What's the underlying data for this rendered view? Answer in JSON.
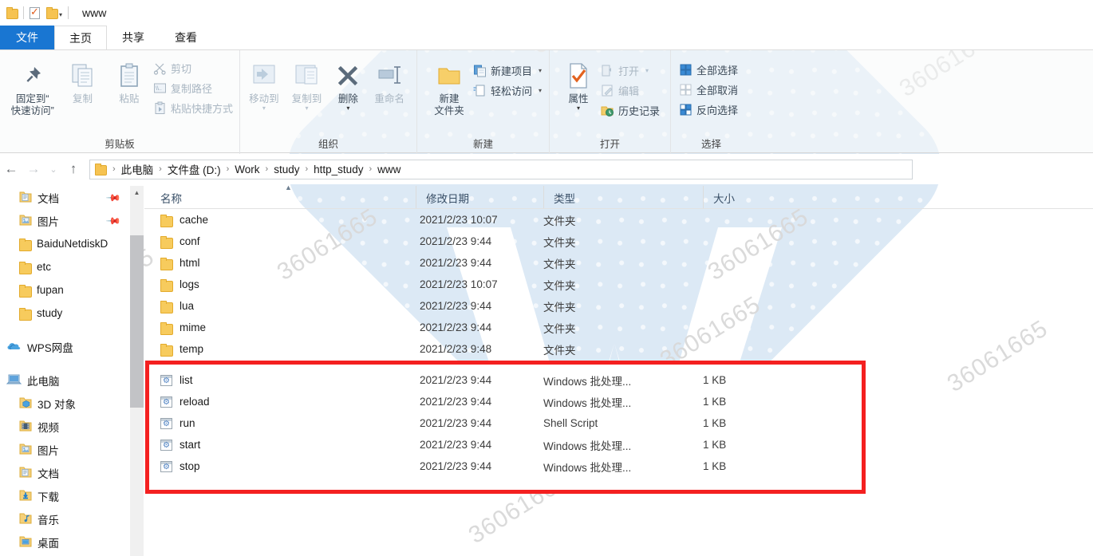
{
  "window": {
    "title": "www",
    "quick_access": {
      "folder_icon": "folder-icon",
      "properties_icon": "properties-check-icon",
      "new_folder_icon": "folder-icon",
      "customize_caret": "chevron-down-icon"
    }
  },
  "tabs": [
    {
      "label": "文件",
      "type": "file",
      "active": false
    },
    {
      "label": "主页",
      "type": "normal",
      "active": true
    },
    {
      "label": "共享",
      "type": "normal",
      "active": false
    },
    {
      "label": "查看",
      "type": "normal",
      "active": false
    }
  ],
  "ribbon": {
    "groups": [
      {
        "title": "剪贴板",
        "big_buttons": [
          {
            "label": "固定到“\n快速访问”",
            "line1": "固定到“",
            "line2": "快速访问”",
            "icon": "pin-icon",
            "dim": false
          },
          {
            "label": "复制",
            "line1": "复制",
            "line2": "",
            "icon": "copy-icon",
            "dim": true
          },
          {
            "label": "粘贴",
            "line1": "粘贴",
            "line2": "",
            "icon": "paste-icon",
            "dim": true
          }
        ],
        "small_buttons": [
          {
            "label": "剪切",
            "icon": "scissors-icon",
            "dim": true
          },
          {
            "label": "复制路径",
            "icon": "copy-path-icon",
            "dim": true
          },
          {
            "label": "粘贴快捷方式",
            "icon": "paste-shortcut-icon",
            "dim": true
          }
        ]
      },
      {
        "title": "组织",
        "big_buttons": [
          {
            "label": "移动到",
            "line1": "移动到",
            "line2": "",
            "icon": "move-to-icon",
            "dim": true,
            "caret": true
          },
          {
            "label": "复制到",
            "line1": "复制到",
            "line2": "",
            "icon": "copy-to-icon",
            "dim": true,
            "caret": true
          },
          {
            "label": "删除",
            "line1": "删除",
            "line2": "",
            "icon": "delete-x-icon",
            "dim": false,
            "caret": true
          },
          {
            "label": "重命名",
            "line1": "重命名",
            "line2": "",
            "icon": "rename-icon",
            "dim": true
          }
        ],
        "small_buttons": []
      },
      {
        "title": "新建",
        "big_buttons": [
          {
            "label": "新建\n文件夹",
            "line1": "新建",
            "line2": "文件夹",
            "icon": "new-folder-icon",
            "dim": false
          }
        ],
        "small_buttons": [
          {
            "label": "新建项目",
            "icon": "new-item-icon",
            "dim": false,
            "caret": true
          },
          {
            "label": "轻松访问",
            "icon": "easy-access-icon",
            "dim": false,
            "caret": true
          }
        ]
      },
      {
        "title": "打开",
        "big_buttons": [
          {
            "label": "属性",
            "line1": "属性",
            "line2": "",
            "icon": "properties-check-icon",
            "dim": false,
            "caret": true
          }
        ],
        "small_buttons": [
          {
            "label": "打开",
            "icon": "open-icon",
            "dim": true,
            "caret": true
          },
          {
            "label": "编辑",
            "icon": "edit-pencil-icon",
            "dim": true
          },
          {
            "label": "历史记录",
            "icon": "history-icon",
            "dim": false
          }
        ]
      },
      {
        "title": "选择",
        "big_buttons": [],
        "small_buttons": [
          {
            "label": "全部选择",
            "icon": "select-all-icon",
            "dim": false
          },
          {
            "label": "全部取消",
            "icon": "select-none-icon",
            "dim": false
          },
          {
            "label": "反向选择",
            "icon": "invert-selection-icon",
            "dim": false
          }
        ]
      }
    ]
  },
  "addressbar": {
    "back_icon": "arrow-left-icon",
    "forward_icon": "arrow-right-icon",
    "recent_icon": "chevron-down-icon",
    "up_icon": "arrow-up-icon",
    "folder_icon": "folder-icon",
    "separator": "›",
    "breadcrumbs": [
      "此电脑",
      "文件盘 (D:)",
      "Work",
      "study",
      "http_study",
      "www"
    ]
  },
  "navpane": {
    "items": [
      {
        "label": "文档",
        "icon": "documents-folder-icon",
        "indent": 1,
        "pinned": true
      },
      {
        "label": "图片",
        "icon": "pictures-folder-icon",
        "indent": 1,
        "pinned": true
      },
      {
        "label": "BaiduNetdiskD",
        "icon": "folder-icon",
        "indent": 1,
        "pinned": false
      },
      {
        "label": "etc",
        "icon": "folder-icon",
        "indent": 1,
        "pinned": false
      },
      {
        "label": "fupan",
        "icon": "folder-icon",
        "indent": 1,
        "pinned": false
      },
      {
        "label": "study",
        "icon": "folder-icon",
        "indent": 1,
        "pinned": false
      },
      {
        "label": "WPS网盘",
        "icon": "cloud-icon",
        "indent": 0,
        "pinned": false,
        "gap_before": true
      },
      {
        "label": "此电脑",
        "icon": "this-pc-icon",
        "indent": 0,
        "pinned": false,
        "gap_before": true
      },
      {
        "label": "3D 对象",
        "icon": "3d-objects-icon",
        "indent": 1,
        "pinned": false
      },
      {
        "label": "视频",
        "icon": "videos-folder-icon",
        "indent": 1,
        "pinned": false
      },
      {
        "label": "图片",
        "icon": "pictures-folder-icon",
        "indent": 1,
        "pinned": false
      },
      {
        "label": "文档",
        "icon": "documents-folder-icon",
        "indent": 1,
        "pinned": false
      },
      {
        "label": "下载",
        "icon": "downloads-folder-icon",
        "indent": 1,
        "pinned": false
      },
      {
        "label": "音乐",
        "icon": "music-folder-icon",
        "indent": 1,
        "pinned": false
      },
      {
        "label": "桌面",
        "icon": "desktop-folder-icon",
        "indent": 1,
        "pinned": false
      }
    ]
  },
  "filelist": {
    "columns": [
      {
        "label": "名称",
        "key": "name"
      },
      {
        "label": "修改日期",
        "key": "date"
      },
      {
        "label": "类型",
        "key": "type"
      },
      {
        "label": "大小",
        "key": "size"
      }
    ],
    "sort_indicator": "sort-ascending-caret-icon",
    "folders": [
      {
        "name": "cache",
        "date": "2021/2/23 10:07",
        "type": "文件夹",
        "size": "",
        "icon": "folder-icon"
      },
      {
        "name": "conf",
        "date": "2021/2/23 9:44",
        "type": "文件夹",
        "size": "",
        "icon": "folder-icon"
      },
      {
        "name": "html",
        "date": "2021/2/23 9:44",
        "type": "文件夹",
        "size": "",
        "icon": "folder-icon"
      },
      {
        "name": "logs",
        "date": "2021/2/23 10:07",
        "type": "文件夹",
        "size": "",
        "icon": "folder-icon"
      },
      {
        "name": "lua",
        "date": "2021/2/23 9:44",
        "type": "文件夹",
        "size": "",
        "icon": "folder-icon"
      },
      {
        "name": "mime",
        "date": "2021/2/23 9:44",
        "type": "文件夹",
        "size": "",
        "icon": "folder-icon"
      },
      {
        "name": "temp",
        "date": "2021/2/23 9:48",
        "type": "文件夹",
        "size": "",
        "icon": "folder-icon"
      }
    ],
    "files": [
      {
        "name": "list",
        "date": "2021/2/23 9:44",
        "type": "Windows 批处理...",
        "size": "1 KB",
        "icon": "batch-file-icon"
      },
      {
        "name": "reload",
        "date": "2021/2/23 9:44",
        "type": "Windows 批处理...",
        "size": "1 KB",
        "icon": "batch-file-icon"
      },
      {
        "name": "run",
        "date": "2021/2/23 9:44",
        "type": "Shell Script",
        "size": "1 KB",
        "icon": "batch-file-icon"
      },
      {
        "name": "start",
        "date": "2021/2/23 9:44",
        "type": "Windows 批处理...",
        "size": "1 KB",
        "icon": "batch-file-icon"
      },
      {
        "name": "stop",
        "date": "2021/2/23 9:44",
        "type": "Windows 批处理...",
        "size": "1 KB",
        "icon": "batch-file-icon"
      }
    ]
  },
  "annotation": {
    "highlight_box_color": "#f42020",
    "highlight_box_name": "script-files-highlight"
  },
  "watermark": {
    "text": "36061665",
    "color": "#d9d9d9"
  },
  "colors": {
    "accent": "#1976d2",
    "ribbon_bg": "#f7f9fa",
    "folder_yellow": "#f7cb5d",
    "header_text": "#3a5068"
  }
}
